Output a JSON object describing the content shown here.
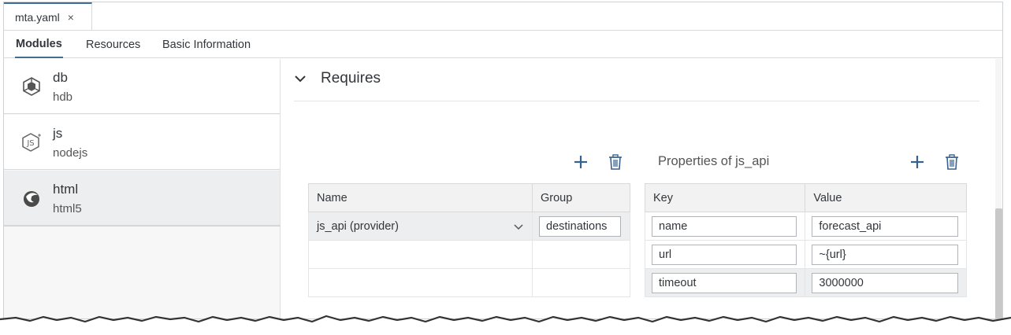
{
  "file_tab": {
    "name": "mta.yaml",
    "close": "×"
  },
  "editor_tabs": [
    {
      "label": "Modules"
    },
    {
      "label": "Resources"
    },
    {
      "label": "Basic Information"
    }
  ],
  "modules": [
    {
      "name": "db",
      "type": "hdb",
      "icon": "hdb-module-icon"
    },
    {
      "name": "js",
      "type": "nodejs",
      "icon": "nodejs-module-icon"
    },
    {
      "name": "html",
      "type": "html5",
      "icon": "html5-module-icon"
    }
  ],
  "requires": {
    "title": "Requires",
    "table": {
      "headers": [
        "Name",
        "Group"
      ],
      "rows": [
        {
          "name": "js_api (provider)",
          "group": "destinations"
        },
        {
          "name": "",
          "group": ""
        },
        {
          "name": "",
          "group": ""
        }
      ]
    }
  },
  "properties": {
    "title": "Properties of js_api",
    "headers": [
      "Key",
      "Value"
    ],
    "rows": [
      {
        "key": "name",
        "value": "forecast_api"
      },
      {
        "key": "url",
        "value": "~{url}"
      },
      {
        "key": "timeout",
        "value": "3000000"
      }
    ]
  },
  "colors": {
    "accent": "#3f6d94",
    "icon_blue": "#35618e"
  }
}
